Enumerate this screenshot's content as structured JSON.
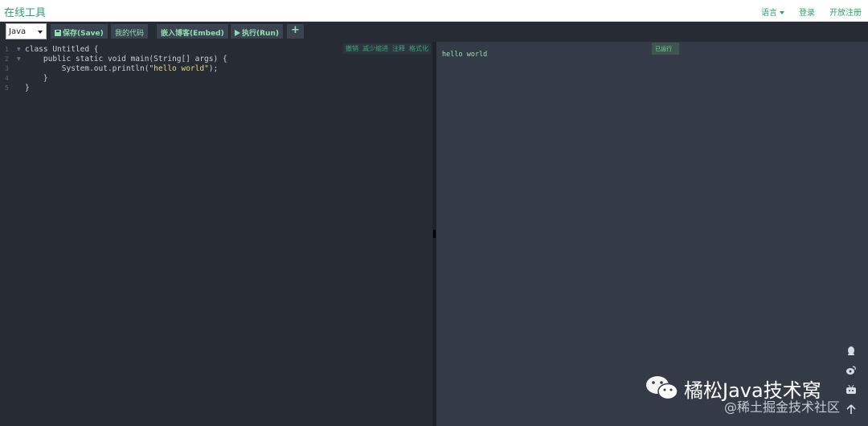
{
  "header": {
    "brand": "在线工具",
    "nav": {
      "language": "语言",
      "login": "登录",
      "register": "开放注册"
    }
  },
  "toolbar": {
    "language_value": "Java",
    "save_label": "保存(Save)",
    "my_code_label": "我的代码",
    "embed_label": "嵌入博客(Embed)",
    "run_label": "执行(Run)",
    "add_label": "+"
  },
  "editor": {
    "tools": [
      "撤销",
      "减少缩进",
      "注释",
      "格式化"
    ],
    "lines": [
      {
        "num": "1",
        "fold": true,
        "code": "class Untitled {"
      },
      {
        "num": "2",
        "fold": true,
        "code": "    public static void main(String[] args) {"
      },
      {
        "num": "3",
        "fold": false,
        "code_pre": "        System.out.println(",
        "code_str": "\"hello world\"",
        "code_post": ");"
      },
      {
        "num": "4",
        "fold": false,
        "code": "    }"
      },
      {
        "num": "5",
        "fold": false,
        "code": "}"
      }
    ]
  },
  "output": {
    "text": "hello world",
    "tag": "已运行"
  },
  "side_icons": [
    "qq-icon",
    "weibo-icon",
    "bilibili-icon",
    "back-to-top-icon"
  ],
  "watermark": {
    "title": "橘松Java技术窝",
    "subtitle": "@稀土掘金技术社区"
  },
  "colors": {
    "accent": "#2e9e6e",
    "editor_bg": "#272b33",
    "output_bg": "#353b46",
    "output_text": "#8ee0b0"
  }
}
